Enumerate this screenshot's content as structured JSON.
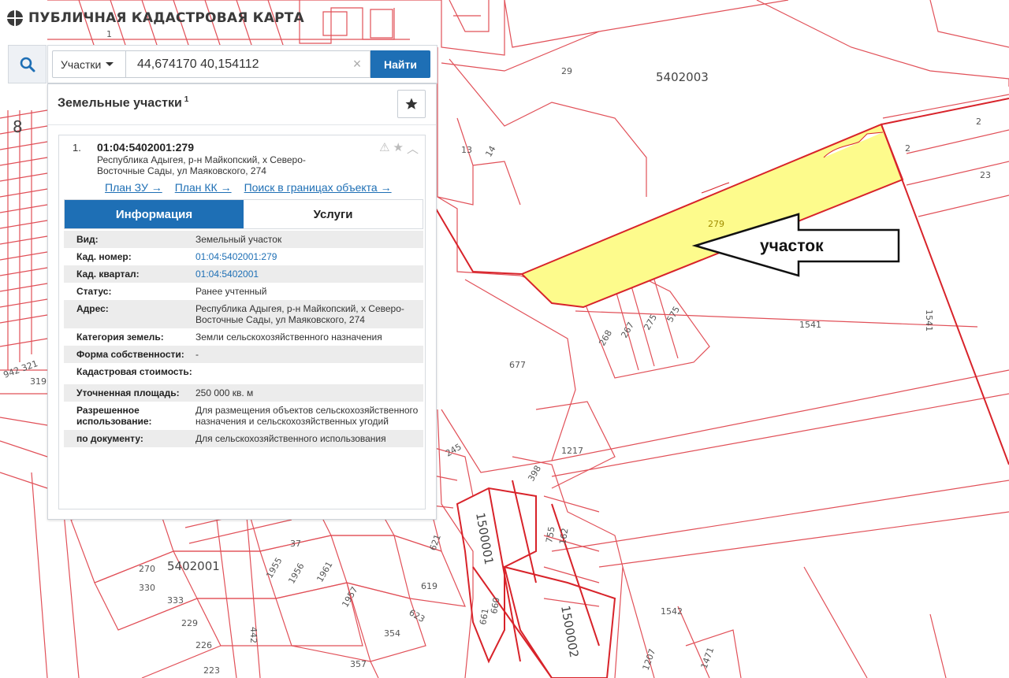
{
  "app": {
    "title": "ПУБЛИЧНАЯ КАДАСТРОВАЯ КАРТА"
  },
  "search": {
    "type_label": "Участки",
    "query": "44,674170 40,154112",
    "clear_label": "×",
    "find_label": "Найти"
  },
  "panel": {
    "title": "Земельные участки",
    "count": "1"
  },
  "result": {
    "index": "1.",
    "cad_number": "01:04:5402001:279",
    "address": "Республика Адыгея, р-н Майкопский, х Северо-Восточные Сады, ул Маяковского, 274",
    "links": [
      "План ЗУ →",
      "План КК →",
      "Поиск в границах объекта →"
    ],
    "tabs": [
      "Информация",
      "Услуги"
    ],
    "rows": [
      {
        "k": "Вид:",
        "v": "Земельный участок"
      },
      {
        "k": "Кад. номер:",
        "v": "01:04:5402001:279"
      },
      {
        "k": "Кад. квартал:",
        "v": "01:04:5402001"
      },
      {
        "k": "Статус:",
        "v": "Ранее учтенный"
      },
      {
        "k": "Адрес:",
        "v": "Республика Адыгея, р-н Майкопский, х Северо-Восточные Сады, ул Маяковского, 274"
      },
      {
        "k": "Категория земель:",
        "v": "Земли сельскохозяйственного назначения"
      },
      {
        "k": "Форма собственности:",
        "v": "-"
      },
      {
        "k": "Кадастровая стоимость:",
        "v": ""
      },
      {
        "k": "Уточненная площадь:",
        "v": "250 000 кв. м"
      },
      {
        "k": "Разрешенное использование:",
        "v": "Для размещения объектов сельскохозяйственного назначения и сельскохозяйственных угодий"
      },
      {
        "k": "по документу:",
        "v": "Для сельскохозяйственного использования"
      }
    ]
  },
  "map": {
    "annotation": "участок",
    "highlight_color": "#fdfb8c",
    "boundary_color": "#d8232a",
    "labels": [
      "5402003",
      "29",
      "2",
      "2",
      "23",
      "13",
      "14",
      "279",
      "1541",
      "1541",
      "677",
      "268",
      "267",
      "275",
      "575",
      "1217",
      "245",
      "398",
      "5402001",
      "270",
      "330",
      "333",
      "229",
      "226",
      "223",
      "37",
      "1955",
      "1956",
      "1961",
      "1957",
      "442",
      "621",
      "619",
      "623",
      "354",
      "357",
      "1500001",
      "755",
      "162",
      "660",
      "661",
      "1500002",
      "1542",
      "1207",
      "1471",
      "8",
      "942 321",
      "319",
      "1"
    ]
  },
  "colors": {
    "accent": "#1e6fb5",
    "row_gray": "#ececec"
  }
}
